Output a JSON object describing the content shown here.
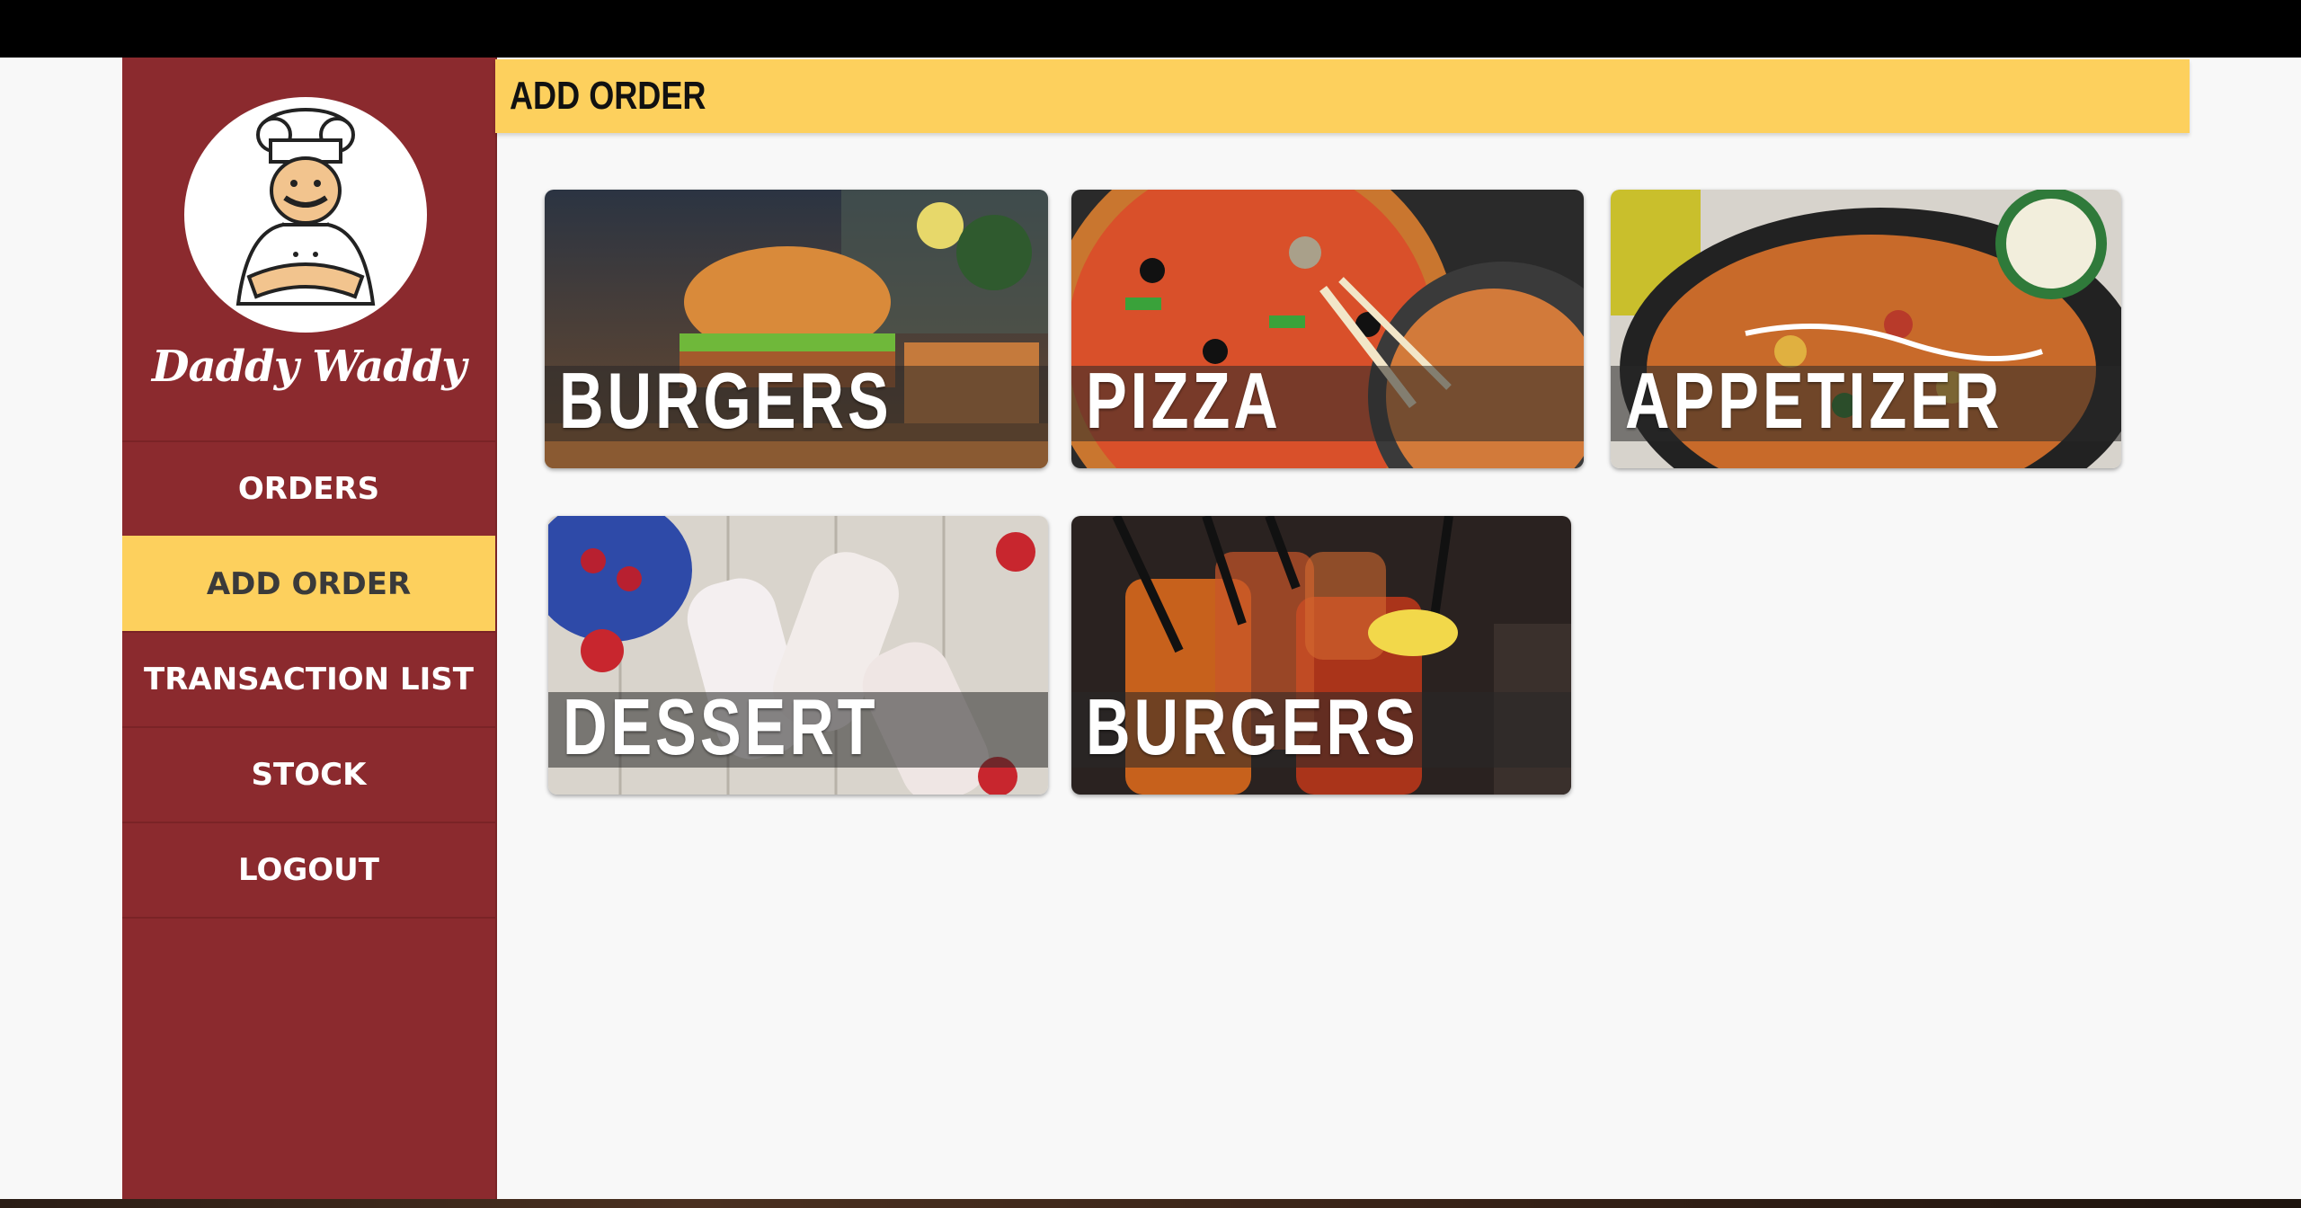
{
  "brand": {
    "name": "Daddy Waddy"
  },
  "nav": {
    "items": [
      {
        "label": "ORDERS",
        "active": false
      },
      {
        "label": "ADD ORDER",
        "active": true
      },
      {
        "label": "TRANSACTION LIST",
        "active": false
      },
      {
        "label": "STOCK",
        "active": false
      },
      {
        "label": "LOGOUT",
        "active": false
      }
    ]
  },
  "header": {
    "title": "ADD ORDER"
  },
  "categories": [
    {
      "label": "BURGERS",
      "image": "burger-photo"
    },
    {
      "label": "PIZZA",
      "image": "pizza-photo"
    },
    {
      "label": "APPETIZER",
      "image": "appetizer-photo"
    },
    {
      "label": "DESSERT",
      "image": "dessert-photo"
    },
    {
      "label": "BURGERS",
      "image": "drinks-photo"
    }
  ],
  "colors": {
    "sidebar": "#8b2a2e",
    "accent": "#fdd05d",
    "page_bg": "#f8f8f8"
  }
}
